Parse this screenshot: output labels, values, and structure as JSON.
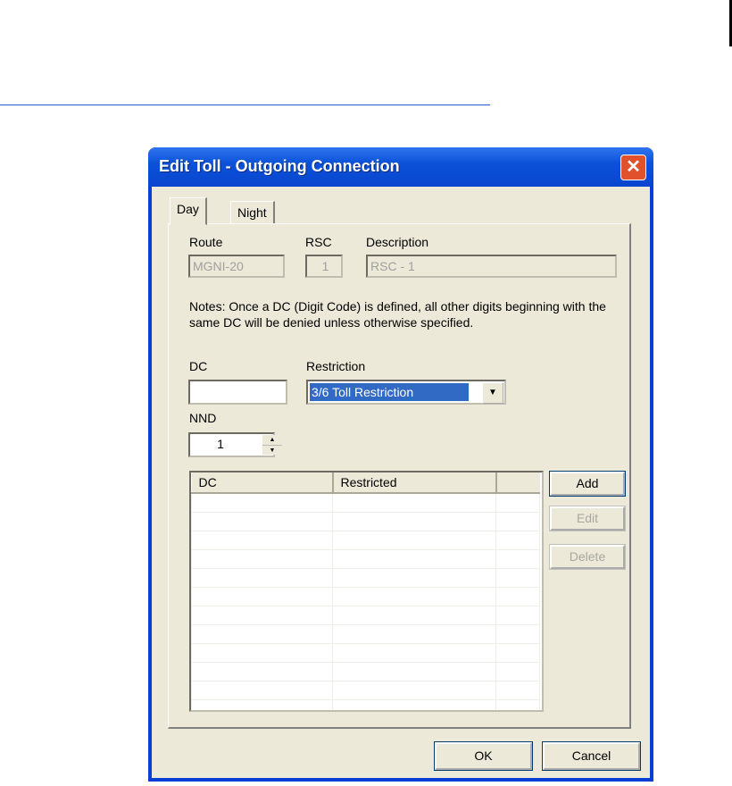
{
  "dialog": {
    "title": "Edit Toll - Outgoing Connection",
    "close": "✕"
  },
  "tabs": [
    {
      "label": "Day"
    },
    {
      "label": "Night"
    }
  ],
  "route": {
    "label": "Route",
    "value": "MGNI-20"
  },
  "rsc": {
    "label": "RSC",
    "value": "1"
  },
  "description": {
    "label": "Description",
    "value": "RSC - 1"
  },
  "notes": "Notes: Once a DC (Digit Code) is defined, all other digits beginning with the same DC will be denied unless otherwise specified.",
  "dc": {
    "label": "DC",
    "value": ""
  },
  "restriction": {
    "label": "Restriction",
    "value": "3/6 Toll Restriction"
  },
  "nnd": {
    "label": "NND",
    "value": "1"
  },
  "table": {
    "headers": [
      "DC",
      "Restricted",
      ""
    ],
    "rows": []
  },
  "buttons": {
    "add": "Add",
    "edit": "Edit",
    "delete": "Delete",
    "ok": "OK",
    "cancel": "Cancel"
  }
}
